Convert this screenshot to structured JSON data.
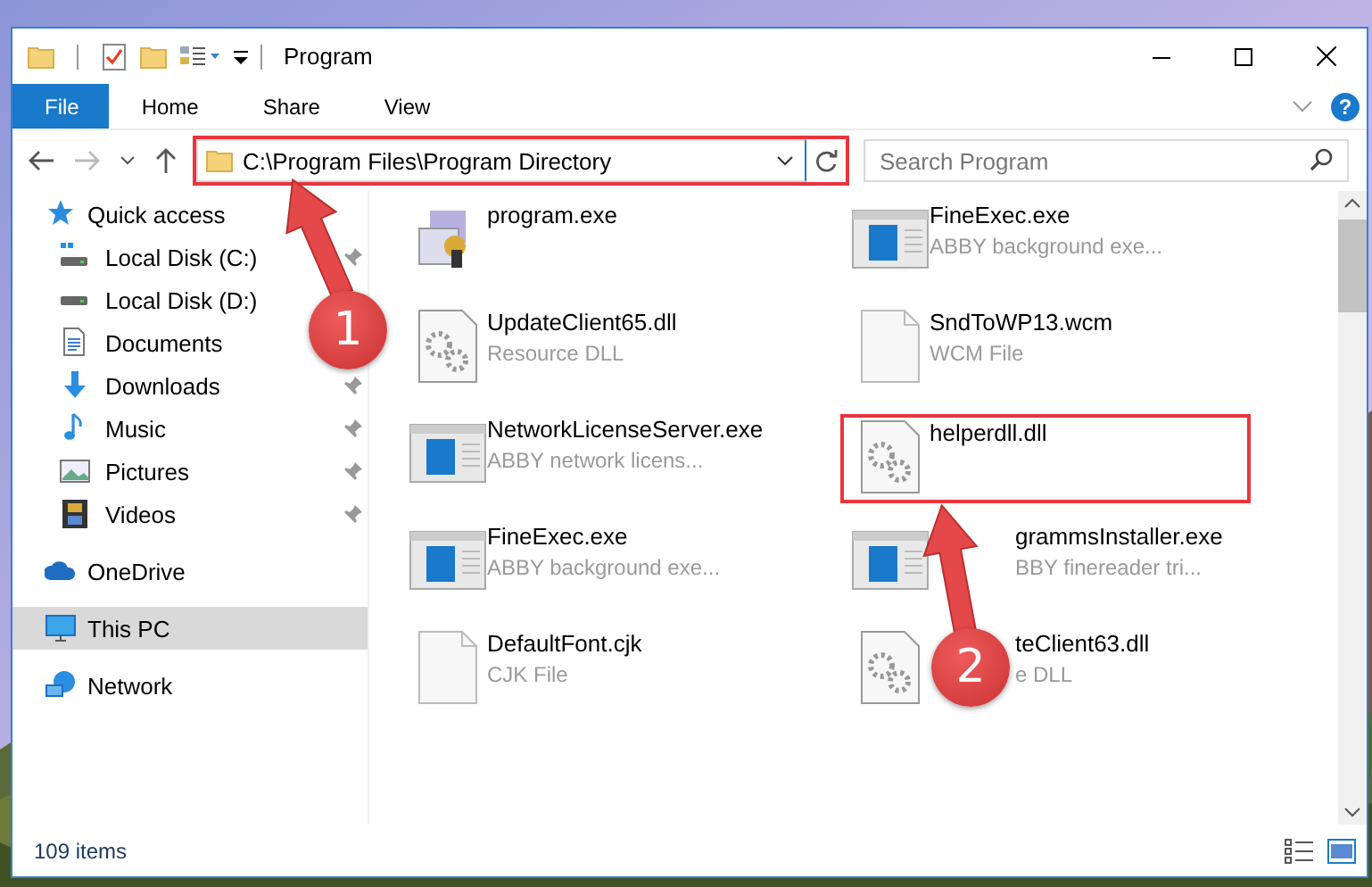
{
  "title_bar": {
    "title": "Program"
  },
  "ribbon": {
    "tabs": [
      {
        "label": "File",
        "kind": "menu"
      },
      {
        "label": "Home",
        "kind": "tab"
      },
      {
        "label": "Share",
        "kind": "tab"
      },
      {
        "label": "View",
        "kind": "tab"
      }
    ],
    "help": "?"
  },
  "address_bar": {
    "path": "C:\\Program Files\\Program Directory",
    "highlighted": true
  },
  "search": {
    "placeholder": "Search Program"
  },
  "navigation": [
    {
      "label": "Quick access",
      "selected": false,
      "children": [
        {
          "label": "Local Disk (C:)",
          "selected": false,
          "pinned": true
        },
        {
          "label": "Local Disk (D:)",
          "selected": false
        },
        {
          "label": "Documents",
          "selected": false
        },
        {
          "label": "Downloads",
          "selected": false,
          "pinned": true
        },
        {
          "label": "Music",
          "selected": false,
          "pinned": true
        },
        {
          "label": "Pictures",
          "selected": false,
          "pinned": true
        },
        {
          "label": "Videos",
          "selected": false,
          "pinned": true
        }
      ]
    },
    {
      "label": "OneDrive",
      "selected": false
    },
    {
      "label": "This PC",
      "selected": true
    },
    {
      "label": "Network",
      "selected": false
    }
  ],
  "files": [
    {
      "name": "program.exe",
      "kind": "program",
      "highlighted": false,
      "covered": false
    },
    {
      "name": "FineExec.exe",
      "description": "ABBY background exe...",
      "kind": "window",
      "highlighted": false,
      "covered": false
    },
    {
      "name": "UpdateClient65.dll",
      "description": "Resource DLL",
      "kind": "dll",
      "highlighted": false,
      "covered": false
    },
    {
      "name": "SndToWP13.wcm",
      "description": "WCM File",
      "kind": "document",
      "highlighted": false,
      "covered": false
    },
    {
      "name": "NetworkLicenseServer.exe",
      "description": "ABBY network licens...",
      "kind": "window",
      "highlighted": false,
      "covered": false
    },
    {
      "name": "helperdll.dll",
      "kind": "dll",
      "highlighted": true,
      "covered": false
    },
    {
      "name": "FineExec.exe",
      "description": "ABBY background exe...",
      "kind": "window",
      "highlighted": false,
      "covered": false
    },
    {
      "name": "grammsInstaller.exe",
      "description": "BBY finereader tri...",
      "kind": "window",
      "highlighted": false,
      "covered": true
    },
    {
      "name": "DefaultFont.cjk",
      "description": "CJK File",
      "kind": "document",
      "highlighted": false,
      "covered": false
    },
    {
      "name": "teClient63.dll",
      "description": "e DLL",
      "kind": "dll",
      "highlighted": false,
      "covered": true
    }
  ],
  "status_bar": {
    "item_count": "109 items"
  },
  "callouts": [
    {
      "number": "1"
    },
    {
      "number": "2"
    }
  ]
}
